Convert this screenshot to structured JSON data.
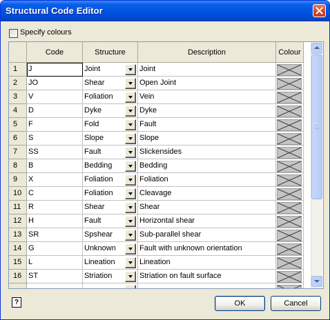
{
  "window": {
    "title": "Structural Code Editor"
  },
  "options": {
    "specify_colours_label": "Specify colours",
    "specify_colours_checked": false
  },
  "grid": {
    "columns": [
      "Code",
      "Structure",
      "Description",
      "Colour"
    ],
    "rows": [
      {
        "num": "1",
        "code": "J",
        "structure": "Joint",
        "description": "Joint"
      },
      {
        "num": "2",
        "code": "JO",
        "structure": "Shear",
        "description": "Open Joint"
      },
      {
        "num": "3",
        "code": "V",
        "structure": "Foliation",
        "description": "Vein"
      },
      {
        "num": "4",
        "code": "D",
        "structure": "Dyke",
        "description": "Dyke"
      },
      {
        "num": "5",
        "code": "F",
        "structure": "Fold",
        "description": "Fault"
      },
      {
        "num": "6",
        "code": "S",
        "structure": "Slope",
        "description": "Slope"
      },
      {
        "num": "7",
        "code": "SS",
        "structure": "Fault",
        "description": "Slickensides"
      },
      {
        "num": "8",
        "code": "B",
        "structure": "Bedding",
        "description": "Bedding"
      },
      {
        "num": "9",
        "code": "X",
        "structure": "Foliation",
        "description": "Foliation"
      },
      {
        "num": "10",
        "code": "C",
        "structure": "Foliation",
        "description": "Cleavage"
      },
      {
        "num": "11",
        "code": "R",
        "structure": "Shear",
        "description": "Shear"
      },
      {
        "num": "12",
        "code": "H",
        "structure": "Fault",
        "description": "Horizontal shear"
      },
      {
        "num": "13",
        "code": "SR",
        "structure": "Spshear",
        "description": "Sub-parallel shear"
      },
      {
        "num": "14",
        "code": "G",
        "structure": "Unknown",
        "description": "Fault with unknown orientation"
      },
      {
        "num": "15",
        "code": "L",
        "structure": "Lineation",
        "description": "Lineation"
      },
      {
        "num": "16",
        "code": "ST",
        "structure": "Striation",
        "description": "Striation on fault surface"
      }
    ]
  },
  "buttons": {
    "ok": "OK",
    "cancel": "Cancel",
    "help": "?"
  },
  "colors": {
    "title_bar": "#0054e3",
    "dialog_bg": "#ece9d8",
    "close_button": "#d6482a"
  },
  "icons": {
    "close": "close-icon",
    "help": "help-icon",
    "dropdown": "chevron-down-icon",
    "no_colour": "no-colour-swatch-icon"
  }
}
